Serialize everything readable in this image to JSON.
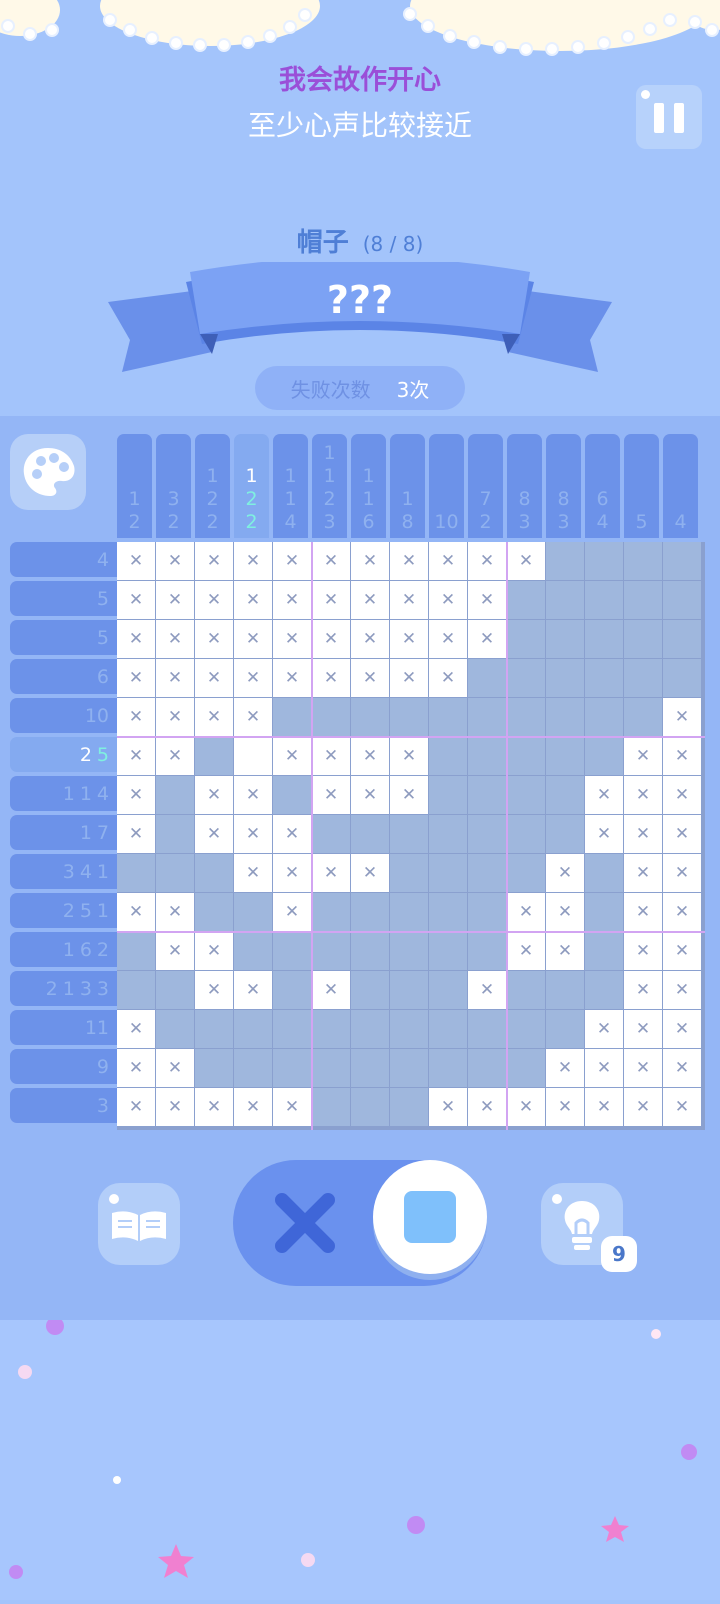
{
  "quote": {
    "line1": "我会故作开心",
    "line2": "至少心声比较接近"
  },
  "puzzle": {
    "name": "帽子",
    "progress": "(8 / 8)",
    "title": "???"
  },
  "fail_counter": {
    "label": "失败次数",
    "value": "3次"
  },
  "column_clues": [
    [
      "1",
      "2"
    ],
    [
      "3",
      "2"
    ],
    [
      "1",
      "2",
      "2"
    ],
    [
      "1",
      "2",
      "2"
    ],
    [
      "1",
      "1",
      "4"
    ],
    [
      "1",
      "1",
      "2",
      "3"
    ],
    [
      "1",
      "1",
      "6"
    ],
    [
      "1",
      "8"
    ],
    [
      "10"
    ],
    [
      "7",
      "2"
    ],
    [
      "8",
      "3"
    ],
    [
      "8",
      "3"
    ],
    [
      "6",
      "4"
    ],
    [
      "5"
    ],
    [
      "4"
    ]
  ],
  "highlighted_column": 3,
  "row_clues": [
    [
      "4"
    ],
    [
      "5"
    ],
    [
      "5"
    ],
    [
      "6"
    ],
    [
      "10"
    ],
    [
      "2",
      "5"
    ],
    [
      "1",
      "1",
      "4"
    ],
    [
      "1",
      "7"
    ],
    [
      "3",
      "4",
      "1"
    ],
    [
      "2",
      "5",
      "1"
    ],
    [
      "1",
      "6",
      "2"
    ],
    [
      "2",
      "1",
      "3",
      "3"
    ],
    [
      "11"
    ],
    [
      "9"
    ],
    [
      "3"
    ]
  ],
  "highlighted_row": 5,
  "grid": [
    "xxxxxxxxxxx....",
    "xxxxxxxxxx.....",
    "xxxxxxxxxx.....",
    "xxxxxxxxx......",
    "xxxx..........x",
    "xx. xxxx.....xx",
    "x.xx.xxx....xxx",
    "x.xxx.......xxx",
    "...xxxx....x.xx",
    "xx..x.....xx.xx",
    ".xx.......xx.xx",
    "..xx.x...x...xx",
    "x...........xxx",
    "xx.........xxxx",
    "xxxxx...xxxxxxx"
  ],
  "controls": {
    "hint_count": "9",
    "active_mode": "fill"
  },
  "colors": {
    "background": "#a3c4fb",
    "filled_cell": "#9fb7dd",
    "clue_bar": "#6c92e9",
    "quote_accent": "#9a4fd8"
  },
  "icons": {
    "palette": "palette-icon",
    "pause": "pause-icon",
    "book": "book-icon",
    "hint": "lightbulb-icon",
    "x_mode": "cross-icon",
    "fill_mode": "square-icon"
  }
}
